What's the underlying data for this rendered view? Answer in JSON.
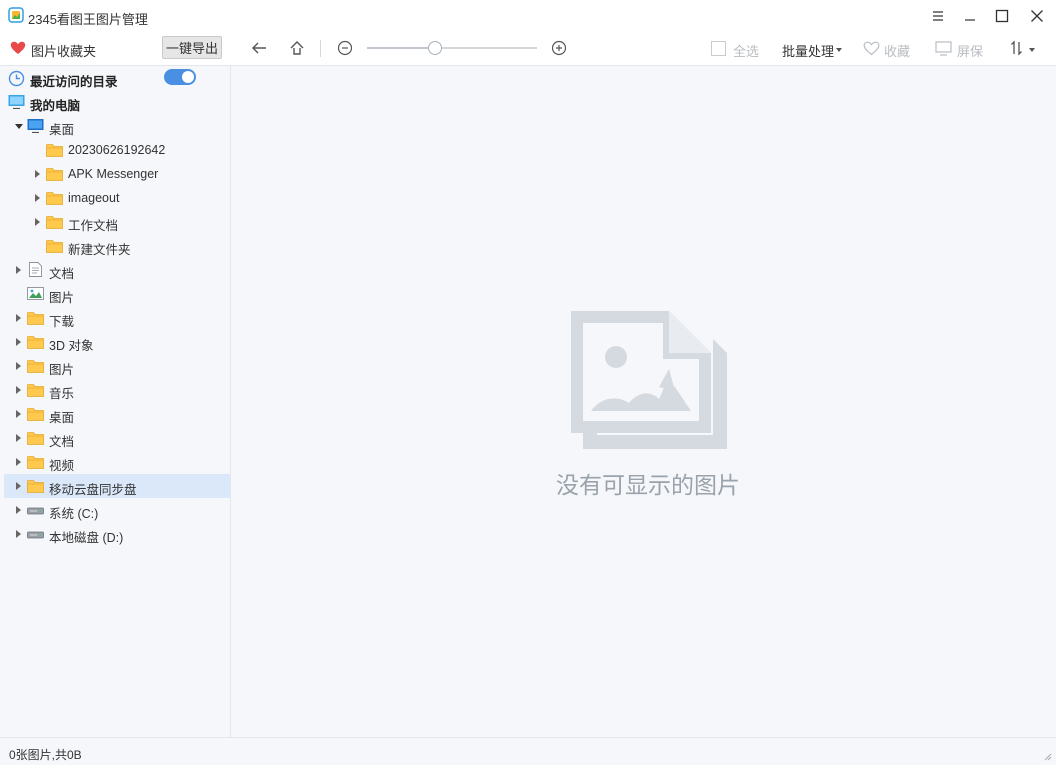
{
  "window": {
    "title": "2345看图王图片管理"
  },
  "toolbar": {
    "favorites_label": "图片收藏夹",
    "export_label": "一键导出",
    "zoom_level": 0.4,
    "select_all_label": "全选",
    "batch_label": "批量处理",
    "favorite_label": "收藏",
    "screensaver_label": "屏保"
  },
  "sidebar": {
    "recent_label": "最近访问的目录",
    "recent_enabled": true,
    "tree": [
      {
        "label": "我的电脑",
        "level": 0,
        "icon": "computer-icon",
        "arrow": "none",
        "bold": true
      },
      {
        "label": "桌面",
        "level": 1,
        "icon": "desktop-icon",
        "arrow": "open"
      },
      {
        "label": "20230626192642",
        "level": 2,
        "icon": "folder-icon",
        "arrow": "none"
      },
      {
        "label": "APK Messenger",
        "level": 2,
        "icon": "folder-icon",
        "arrow": "closed"
      },
      {
        "label": "imageout",
        "level": 2,
        "icon": "folder-icon",
        "arrow": "closed"
      },
      {
        "label": "工作文档",
        "level": 2,
        "icon": "folder-icon",
        "arrow": "closed"
      },
      {
        "label": "新建文件夹",
        "level": 2,
        "icon": "folder-icon",
        "arrow": "none"
      },
      {
        "label": "文档",
        "level": 1,
        "icon": "document-icon",
        "arrow": "closed"
      },
      {
        "label": "图片",
        "level": 1,
        "icon": "picture-icon",
        "arrow": "none"
      },
      {
        "label": "下载",
        "level": 1,
        "icon": "folder-icon",
        "arrow": "closed"
      },
      {
        "label": "3D 对象",
        "level": 1,
        "icon": "folder-icon",
        "arrow": "closed"
      },
      {
        "label": "图片",
        "level": 1,
        "icon": "folder-icon",
        "arrow": "closed"
      },
      {
        "label": "音乐",
        "level": 1,
        "icon": "folder-icon",
        "arrow": "closed"
      },
      {
        "label": "桌面",
        "level": 1,
        "icon": "folder-icon",
        "arrow": "closed"
      },
      {
        "label": "文档",
        "level": 1,
        "icon": "folder-icon",
        "arrow": "closed"
      },
      {
        "label": "视频",
        "level": 1,
        "icon": "folder-icon",
        "arrow": "closed"
      },
      {
        "label": "移动云盘同步盘",
        "level": 1,
        "icon": "folder-icon",
        "arrow": "closed",
        "selected": true
      },
      {
        "label": "系统 (C:)",
        "level": 1,
        "icon": "drive-icon",
        "arrow": "closed"
      },
      {
        "label": "本地磁盘 (D:)",
        "level": 1,
        "icon": "drive-icon",
        "arrow": "closed"
      }
    ]
  },
  "main": {
    "empty_message": "没有可显示的图片"
  },
  "status": {
    "text": "0张图片,共0B"
  },
  "colors": {
    "accent": "#4a90e2",
    "folder": "#ffc94d",
    "folder_edge": "#e3a82b",
    "heart": "#e84a4a",
    "selection": "#dbe8f9",
    "placeholder": "#d5dae0"
  }
}
